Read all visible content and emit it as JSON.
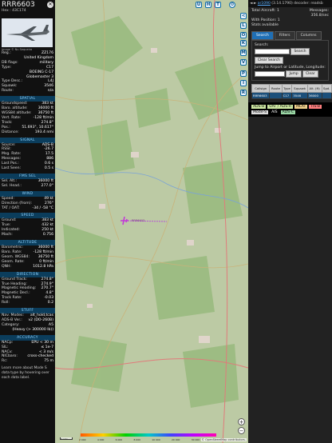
{
  "aircraft": {
    "callsign": "RRR6603",
    "hex_line": "Hex : 43C174",
    "photo_caption": "Image © Nu Sequeira",
    "info_rows": [
      {
        "k": "Reg.:",
        "v": "ZZ176"
      },
      {
        "k": "",
        "v": "United Kingdom"
      },
      {
        "k": "DB flags:",
        "v": "military"
      },
      {
        "k": "Type:",
        "v": "C17"
      },
      {
        "k": "",
        "v": "BOEING C-17"
      },
      {
        "k": "",
        "v": "Globemaster 3"
      },
      {
        "k": "Type Desc.:",
        "v": "L4J"
      },
      {
        "k": "Squawk:",
        "v": "3546"
      },
      {
        "k": "Route:",
        "v": "n/a"
      }
    ]
  },
  "sections": [
    {
      "title": "SPATIAL",
      "rows": [
        {
          "k": "Groundspeed:",
          "v": "383 kt"
        },
        {
          "k": "Baro. altitude:",
          "v": "36000 ft"
        },
        {
          "k": "WGS84 altitude:",
          "v": "36750 ft"
        },
        {
          "k": "Vert. Rate:",
          "v": "-128 ft/min"
        },
        {
          "k": "Track:",
          "v": "274.8°"
        },
        {
          "k": "Pos.:",
          "v": "51.693°, 10.617°"
        },
        {
          "k": "Distance:",
          "v": "193.4 nmi"
        }
      ]
    },
    {
      "title": "SIGNAL",
      "rows": [
        {
          "k": "Source:",
          "v": "ADS-B"
        },
        {
          "k": "RSSI:",
          "v": "-26.7"
        },
        {
          "k": "Msg. Rate:",
          "v": "17.5"
        },
        {
          "k": "Messages:",
          "v": "886"
        },
        {
          "k": "Last Pos.:",
          "v": "0.6 s"
        },
        {
          "k": "Last Seen:",
          "v": "0.5 s"
        }
      ]
    },
    {
      "title": "FMS SEL",
      "rows": [
        {
          "k": "Sel. Alt.:",
          "v": "36000 ft"
        },
        {
          "k": "Sel. Head.:",
          "v": "277.0°"
        }
      ]
    },
    {
      "title": "WIND",
      "rows": [
        {
          "k": "Speed:",
          "v": "49 kt"
        },
        {
          "k": "Direction (from):",
          "v": "276°"
        },
        {
          "k": "TAT / OAT:",
          "v": "-34 / -58 °C"
        }
      ]
    },
    {
      "title": "SPEED",
      "rows": [
        {
          "k": "Ground:",
          "v": "383 kt"
        },
        {
          "k": "True:",
          "v": "432 kt"
        },
        {
          "k": "Indicated:",
          "v": "250 kt"
        },
        {
          "k": "Mach:",
          "v": "0.756"
        }
      ]
    },
    {
      "title": "ALTITUDE",
      "rows": [
        {
          "k": "Barometric:",
          "v": "36000 ft"
        },
        {
          "k": "Baro. Rate:",
          "v": "-128 ft/min"
        },
        {
          "k": "Geom. WGS84:",
          "v": "36750 ft"
        },
        {
          "k": "Geom. Rate:",
          "v": "0 ft/min"
        },
        {
          "k": "QNH:",
          "v": "1012.8 hPa"
        }
      ]
    },
    {
      "title": "DIRECTION",
      "rows": [
        {
          "k": "Ground Track:",
          "v": "274.8°"
        },
        {
          "k": "True Heading:",
          "v": "274.9°"
        },
        {
          "k": "Magnetic Heading:",
          "v": "270.7°"
        },
        {
          "k": "Magnetic Decl.:",
          "v": "4.8°"
        },
        {
          "k": "Track Rate:",
          "v": "-0.03"
        },
        {
          "k": "Roll:",
          "v": "0.2"
        }
      ]
    },
    {
      "title": "STUFF",
      "rows": [
        {
          "k": "Nav. Modes:",
          "v": "alt_hold,tcas"
        },
        {
          "k": "ADS-B Ver.:",
          "v": "v2 (DO-260B)"
        },
        {
          "k": "Category:",
          "v": "A5"
        },
        {
          "k": "",
          "v": "(Heavy (> 300000 lb))"
        }
      ]
    },
    {
      "title": "ACCURACY",
      "rows": [
        {
          "k": "NACp:",
          "v": "EPU < 30 m"
        },
        {
          "k": "SIL:",
          "v": "≤ 1e-7"
        },
        {
          "k": "NACv:",
          "v": "< 3 m/s"
        },
        {
          "k": "NICbaro:",
          "v": "cross-checked"
        },
        {
          "k": "Rc:",
          "v": "75 m"
        }
      ]
    }
  ],
  "footer_note": "Learn more about Mode S data type by hovering over each data label.",
  "map": {
    "buttons_top": [
      "U",
      "H",
      "T"
    ],
    "buttons_side": [
      "<",
      "L",
      "O",
      "K",
      "M",
      "V",
      "P",
      "I",
      "R"
    ],
    "aircraft_label": "RRR6603",
    "attribution": "© OpenStreetMap contributors.",
    "scale_label": "2 nmi",
    "altitude_labels": [
      "2 000",
      "4 000",
      "6 000",
      "8 000",
      "10 000",
      "20 000",
      "30 000",
      "40 000"
    ],
    "zoom_in": "+",
    "zoom_out": "−"
  },
  "sidebar": {
    "top_prefix": "◄ ►",
    "version_link": "ar1090",
    "version_text": "(3.14.1790) decoder: readsb",
    "total_aircraft": "Total Aircraft: 1",
    "messages_label": "Messages:",
    "messages_value": "356.8/sec",
    "with_position": "With Position: 1",
    "stats": "Stats available",
    "tabs": [
      "Search",
      "Filters",
      "Columns"
    ],
    "search_label": "Search:",
    "search_button": "Search",
    "clear_search": "Clear Search",
    "jump_label": "Jump to Airport or Latitude, Longitude:",
    "jump_button": "Jump",
    "clear_button": "Clear",
    "table_headers": [
      "Callsign",
      "Route",
      "Type",
      "Squawk",
      "Alt. (ft)",
      "Spd."
    ],
    "table_row": [
      "RRR6603",
      "",
      "C17",
      "3546",
      "36000",
      ""
    ],
    "legend": [
      {
        "label": "ADS-B",
        "color": "#cfe9a3"
      },
      {
        "label": "UAT / ADS-R",
        "color": "#cfe9a3"
      },
      {
        "label": "MLAT",
        "color": "#f2d28d"
      },
      {
        "label": "TIS-B",
        "color": "#ff7f7f"
      },
      {
        "label": "Mode-S",
        "color": "#dddddd"
      },
      {
        "label": "AIS",
        "color": "#000000"
      },
      {
        "label": "ADS-C",
        "color": "#9bd8a6"
      }
    ]
  }
}
